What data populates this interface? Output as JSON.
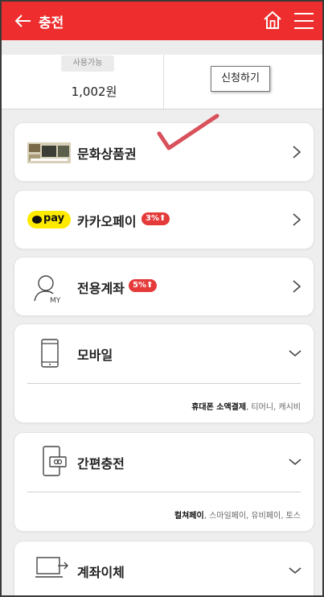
{
  "header": {
    "title": "충전"
  },
  "balance": {
    "available_label": "사용가능",
    "amount": "1,002원",
    "apply_label": "신청하기"
  },
  "methods": {
    "culture": {
      "label": "문화상품권"
    },
    "kakao": {
      "logo_text": "pay",
      "label": "카카오페이",
      "badge": "3%⬆"
    },
    "account": {
      "label": "전용계좌",
      "badge": "5%⬆"
    },
    "mobile": {
      "label": "모바일",
      "sub_bold": "휴대폰 소액결제",
      "sub_rest": ", 티머니, 캐시비"
    },
    "easy": {
      "label": "간편충전",
      "sub_bold": "컬쳐페이",
      "sub_rest": ", 스마일페이, 유비페이, 토스"
    },
    "transfer": {
      "label": "계좌이체"
    }
  },
  "colors": {
    "brand_red": "#ee2e2e",
    "kakao_yellow": "#ffeb00",
    "badge_red": "#e53a3a",
    "check_red": "#d9515a"
  }
}
